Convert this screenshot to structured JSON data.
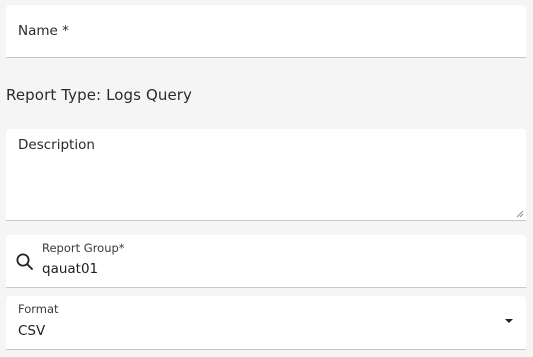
{
  "name_field": {
    "label": "Name *"
  },
  "report_type": {
    "text": "Report Type: Logs Query"
  },
  "description_field": {
    "label": "Description"
  },
  "report_group_field": {
    "label": "Report Group*",
    "value": "qauat01",
    "icon": "search-icon"
  },
  "format_field": {
    "label": "Format",
    "value": "CSV",
    "icon": "caret-down-icon"
  }
}
